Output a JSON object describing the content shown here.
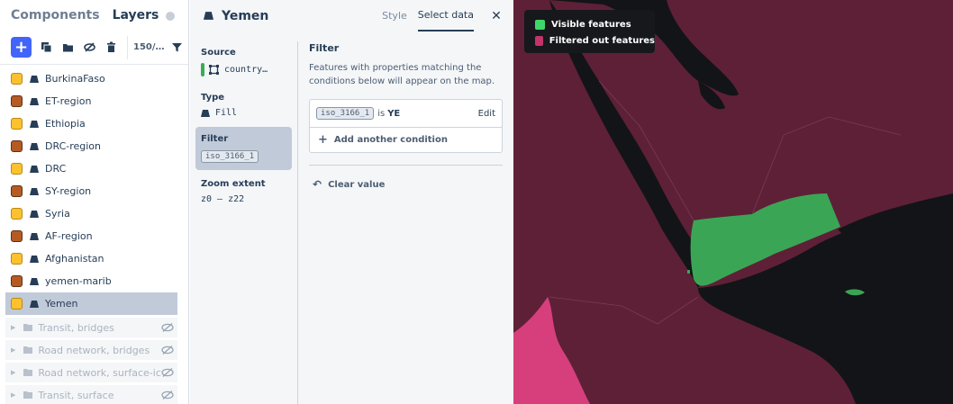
{
  "left_panel": {
    "tabs": {
      "components": "Components",
      "layers": "Layers"
    },
    "toolbar": {
      "count": "150/…"
    },
    "layers": [
      {
        "name": "BurkinaFaso",
        "swatch": "#fcc12e"
      },
      {
        "name": "ET-region",
        "swatch": "#b65a24"
      },
      {
        "name": "Ethiopia",
        "swatch": "#fcc12e"
      },
      {
        "name": "DRC-region",
        "swatch": "#b65a24"
      },
      {
        "name": "DRC",
        "swatch": "#fcc12e"
      },
      {
        "name": "SY-region",
        "swatch": "#b65a24"
      },
      {
        "name": "Syria",
        "swatch": "#fcc12e"
      },
      {
        "name": "AF-region",
        "swatch": "#b65a24"
      },
      {
        "name": "Afghanistan",
        "swatch": "#fcc12e"
      },
      {
        "name": "yemen-marib",
        "swatch": "#b65a24"
      },
      {
        "name": "Yemen",
        "swatch": "#fcc12e",
        "selected": true
      }
    ],
    "groups": [
      {
        "name": "Transit, bridges"
      },
      {
        "name": "Road network, bridges"
      },
      {
        "name": "Road network, surface-icons"
      },
      {
        "name": "Transit, surface"
      }
    ]
  },
  "mid_panel": {
    "title": "Yemen",
    "tabs": {
      "style": "Style",
      "select_data": "Select data"
    },
    "close": "✕",
    "source": {
      "label": "Source",
      "value": "country…"
    },
    "type": {
      "label": "Type",
      "value": "Fill"
    },
    "filter": {
      "label": "Filter",
      "chip": "iso_3166_1"
    },
    "zoom": {
      "label": "Zoom extent",
      "value": "z0 – z22"
    },
    "filter_editor": {
      "title": "Filter",
      "description": "Features with properties matching the conditions below will appear on the map.",
      "condition": {
        "property": "iso_3166_1",
        "operator": "is",
        "value": "YE",
        "edit": "Edit"
      },
      "add_condition": "Add another condition",
      "clear_value": "Clear value"
    }
  },
  "map": {
    "legend": {
      "visible": {
        "label": "Visible features",
        "color": "#3ed66a"
      },
      "filtered": {
        "label": "Filtered out features",
        "color": "#c2346a"
      }
    },
    "colors": {
      "land": "#5e2037",
      "sea": "#131417",
      "highlight": "#3aa655",
      "pink": "#d63f7c"
    }
  }
}
